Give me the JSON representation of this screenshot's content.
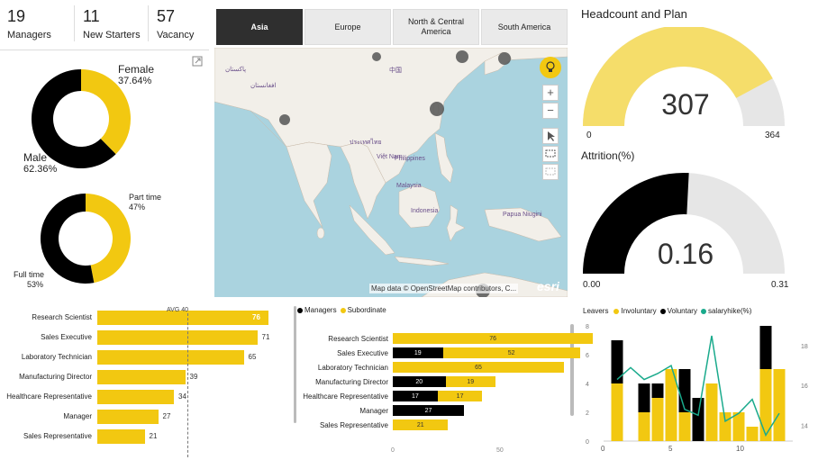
{
  "kpis": [
    {
      "value": "19",
      "label": "Managers"
    },
    {
      "value": "11",
      "label": "New Starters"
    },
    {
      "value": "57",
      "label": "Vacancy"
    }
  ],
  "map": {
    "tabs": [
      "Asia",
      "Europe",
      "North & Central America",
      "South America"
    ],
    "active_tab": "Asia",
    "attribution": "Map data © OpenStreetMap contributors, C...",
    "logo": "esri",
    "place_labels": [
      "Philippines",
      "Malaysia",
      "Indonesia",
      "Papua Niugini",
      "Việt Nam",
      "中国",
      "پاکستان",
      "افغانستان",
      "ประเทศไทย"
    ],
    "zoom_in": "+",
    "zoom_out": "−",
    "colors": {
      "water": "#aad3df",
      "land": "#f2efe9",
      "marker": "#555555"
    }
  },
  "gender_donut": {
    "segments": [
      {
        "name": "Female",
        "percent": "37.64%",
        "value": 37.64,
        "color": "#f2c811"
      },
      {
        "name": "Male",
        "percent": "62.36%",
        "value": 62.36,
        "color": "#000000"
      }
    ]
  },
  "worktime_donut": {
    "segments": [
      {
        "name": "Part time",
        "percent": "47%",
        "value": 47,
        "color": "#f2c811"
      },
      {
        "name": "Full time",
        "percent": "53%",
        "value": 53,
        "color": "#000000"
      }
    ]
  },
  "headcount_gauge": {
    "title": "Headcount and Plan",
    "value": 307,
    "value_label": "307",
    "min": 0,
    "min_label": "0",
    "max": 364,
    "max_label": "364",
    "fill_color": "#f5dd6a",
    "track_color": "#e6e6e6"
  },
  "attrition_gauge": {
    "title": "Attrition(%)",
    "value": 0.16,
    "value_label": "0.16",
    "min": 0,
    "min_label": "0.00",
    "max": 0.31,
    "max_label": "0.31",
    "fill_color": "#000000",
    "track_color": "#e6e6e6"
  },
  "role_bars": {
    "avg_label": "AVG 40",
    "avg": 40,
    "max": 80,
    "bar_color": "#f2c811",
    "highlight_color": "#ffffff",
    "categories": [
      "Research Scientist",
      "Sales Executive",
      "Laboratory Technician",
      "Manufacturing Director",
      "Healthcare Representative",
      "Manager",
      "Sales Representative"
    ],
    "values": [
      76,
      71,
      65,
      39,
      34,
      27,
      21
    ],
    "value_labels": [
      "76",
      "71",
      "65",
      "39",
      "34",
      "27",
      "21"
    ]
  },
  "chart_data": [
    {
      "type": "bar",
      "categories": [
        "Managers",
        "Subordinate"
      ],
      "legend": [
        "Managers",
        "Subordinate"
      ],
      "series_colors": [
        "#000000",
        "#f2c811"
      ],
      "rows": [
        "Research Scientist",
        "Sales Executive",
        "Laboratory Technician",
        "Manufacturing Director",
        "Healthcare Representative",
        "Manager",
        "Sales Representative"
      ],
      "series": [
        {
          "name": "Managers",
          "values": [
            0,
            19,
            0,
            20,
            17,
            27,
            0
          ],
          "labels": [
            "",
            "19",
            "",
            "20",
            "17",
            "27",
            ""
          ]
        },
        {
          "name": "Subordinate",
          "values": [
            76,
            52,
            65,
            19,
            17,
            0,
            21
          ],
          "labels": [
            "76",
            "52",
            "65",
            "19",
            "17",
            "",
            "21"
          ]
        }
      ],
      "xlim": [
        0,
        80
      ],
      "x_ticks": [
        "0",
        "50"
      ]
    },
    {
      "type": "bar",
      "title": "Leavers",
      "legend": [
        "Involuntary",
        "Voluntary",
        "salaryhike(%)"
      ],
      "series_colors": [
        "#f2c811",
        "#000000",
        "#1aaa8c"
      ],
      "x": [
        1,
        2,
        3,
        4,
        5,
        6,
        7,
        8,
        9,
        10,
        11,
        12,
        13
      ],
      "series": [
        {
          "name": "Involuntary",
          "values": [
            4,
            0,
            2,
            3,
            5,
            2,
            0,
            4,
            2,
            2,
            1,
            5,
            5
          ]
        },
        {
          "name": "Voluntary",
          "values": [
            3,
            0,
            2,
            1,
            0,
            3,
            3,
            0,
            0,
            0,
            0,
            3,
            0
          ]
        },
        {
          "name": "salaryhike(%)",
          "values": [
            16.3,
            16.9,
            16.3,
            16.6,
            17.0,
            14.8,
            14.5,
            18.5,
            14.2,
            14.6,
            15.3,
            13.5,
            14.6
          ]
        }
      ],
      "ylim": [
        0,
        8
      ],
      "y_ticks": [
        "0",
        "2",
        "4",
        "6",
        "8"
      ],
      "y2lim": [
        13.2,
        19
      ],
      "y2_ticks": [
        "14",
        "16",
        "18"
      ],
      "x_ticks": [
        "0",
        "5",
        "10"
      ]
    }
  ]
}
